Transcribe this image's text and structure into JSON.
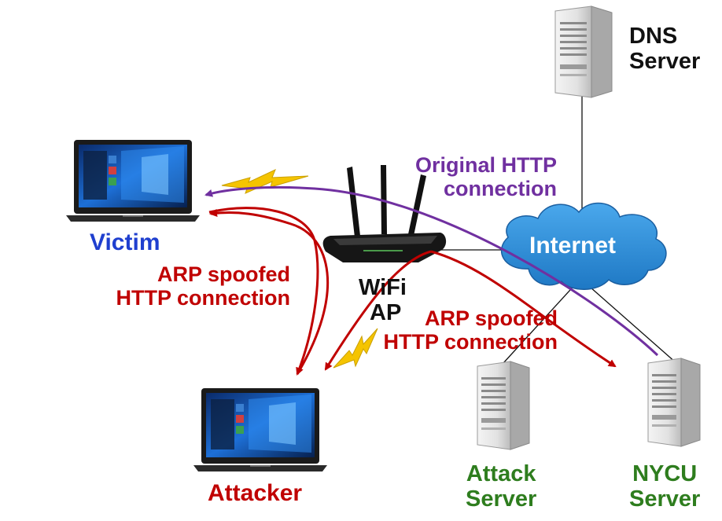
{
  "nodes": {
    "dns_server": {
      "line1": "DNS",
      "line2": "Server",
      "color": "#111111"
    },
    "victim": {
      "label": "Victim",
      "color": "#1f3fcf"
    },
    "attacker": {
      "label": "Attacker",
      "color": "#c00000"
    },
    "wifi_ap": {
      "line1": "WiFi",
      "line2": "AP",
      "color": "#111111"
    },
    "internet": {
      "label": "Internet",
      "color": "#ffffff",
      "cloud_color": "#2a8fd8"
    },
    "attack_server": {
      "line1": "Attack",
      "line2": "Server",
      "color": "#2e7d1e"
    },
    "nycu_server": {
      "line1": "NYCU",
      "line2": "Server",
      "color": "#2e7d1e"
    }
  },
  "connections": {
    "original_http": {
      "line1": "Original HTTP",
      "line2": "connection",
      "color": "#7030a0"
    },
    "arp_spoofed_victim": {
      "line1": "ARP spoofed",
      "line2": "HTTP connection",
      "color": "#c00000"
    },
    "arp_spoofed_server": {
      "line1": "ARP spoofed",
      "line2": "HTTP connection",
      "color": "#c00000"
    }
  },
  "wireless_color": "#f5c400"
}
